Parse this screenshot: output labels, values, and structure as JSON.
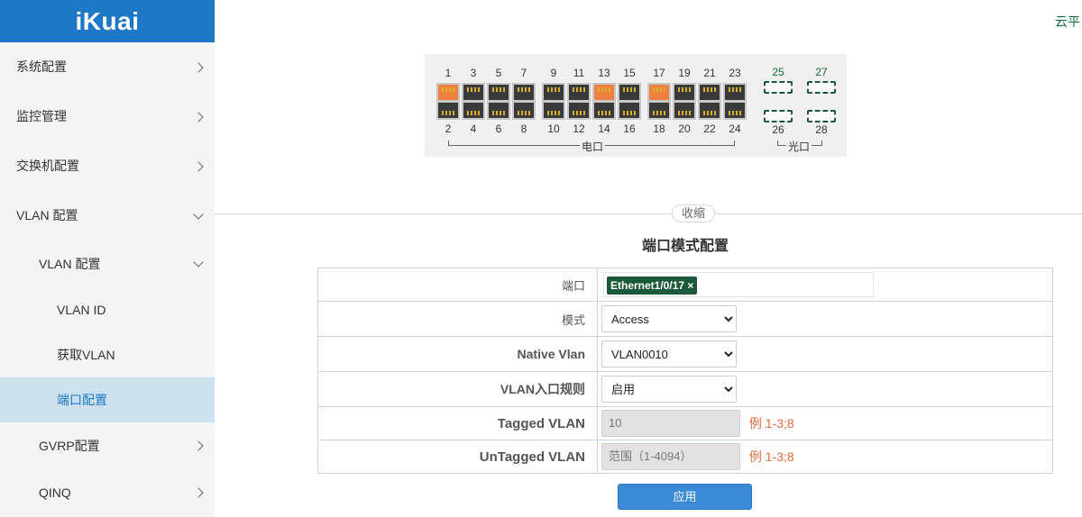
{
  "brand": {
    "logo": "iKuai"
  },
  "header": {
    "topright": "云平"
  },
  "sidebar": {
    "items": [
      {
        "label": "系统配置"
      },
      {
        "label": "监控管理"
      },
      {
        "label": "交换机配置"
      },
      {
        "label": "VLAN 配置"
      },
      {
        "label": "VLAN 配置"
      },
      {
        "label": "VLAN ID"
      },
      {
        "label": "获取VLAN"
      },
      {
        "label": "端口配置"
      },
      {
        "label": "GVRP配置"
      },
      {
        "label": "QINQ"
      }
    ]
  },
  "panel": {
    "top_ports": [
      "1",
      "3",
      "5",
      "7",
      "9",
      "11",
      "13",
      "15",
      "17",
      "19",
      "21",
      "23"
    ],
    "bottom_ports": [
      "2",
      "4",
      "6",
      "8",
      "10",
      "12",
      "14",
      "16",
      "18",
      "20",
      "22",
      "24"
    ],
    "sfp_top": [
      "25",
      "27"
    ],
    "sfp_bottom": [
      "26",
      "28"
    ],
    "electric_label": "电口",
    "optical_label": "光口",
    "colors": {
      "active_port": "#f08040",
      "inactive_port": "#3a3a3a",
      "optical": "#1a5a3a"
    }
  },
  "collapse_label": "收缩",
  "form": {
    "title": "端口模式配置",
    "port_label": "端口",
    "port_tag": "Ethernet1/0/17 ×",
    "mode_label": "模式",
    "mode_value": "Access",
    "native_label": "Native Vlan",
    "native_value": "VLAN0010",
    "ingress_label": "VLAN入口规则",
    "ingress_value": "启用",
    "tagged_label": "Tagged VLAN",
    "tagged_value": "10",
    "tagged_hint": "例 1-3;8",
    "untagged_label": "UnTagged VLAN",
    "untagged_placeholder": "范围（1-4094）",
    "untagged_hint": "例 1-3;8",
    "apply_label": "应用"
  }
}
